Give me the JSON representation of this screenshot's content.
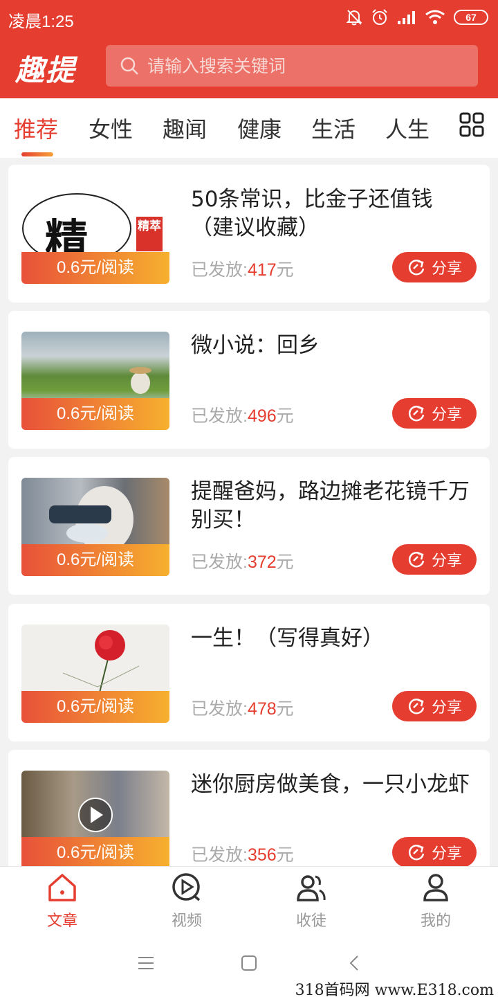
{
  "status_bar": {
    "time": "凌晨1:25",
    "battery": "67",
    "icons": [
      "bell-off-icon",
      "alarm-icon",
      "signal-icon",
      "wifi-icon",
      "battery-icon"
    ]
  },
  "header": {
    "logo": "趣提",
    "search_placeholder": "请输入搜索关键词",
    "search_icon": "search-icon"
  },
  "tabs": {
    "items": [
      "推荐",
      "女性",
      "趣闻",
      "健康",
      "生活",
      "人生"
    ],
    "active": "推荐",
    "more_icon": "grid-icon"
  },
  "feed": {
    "payout_label": "已发放:",
    "currency": "元",
    "share_label": "分享",
    "items": [
      {
        "title": "50条常识，比金子还值钱（建议收藏）",
        "price_badge": "0.6元/阅读",
        "payout": "417"
      },
      {
        "title": "微小说：回乡",
        "price_badge": "0.6元/阅读",
        "payout": "496"
      },
      {
        "title": "提醒爸妈，路边摊老花镜千万别买！",
        "price_badge": "0.6元/阅读",
        "payout": "372"
      },
      {
        "title": "一生！（写得真好）",
        "price_badge": "0.6元/阅读",
        "payout": "478"
      },
      {
        "title": "迷你厨房做美食，一只小龙虾",
        "price_badge": "0.6元/阅读",
        "payout": "356"
      }
    ],
    "thumb_text": "精",
    "thumb_stamp": "精萃"
  },
  "bottom_nav": {
    "items": [
      {
        "label": "文章",
        "icon": "home-icon",
        "active": true
      },
      {
        "label": "视频",
        "icon": "video-icon",
        "active": false
      },
      {
        "label": "收徒",
        "icon": "users-icon",
        "active": false
      },
      {
        "label": "我的",
        "icon": "profile-icon",
        "active": false
      }
    ]
  },
  "watermark": "318首码网 www.E318.com",
  "colors": {
    "primary": "#e53e30",
    "badge_start": "#e8513a",
    "badge_end": "#f6b02e"
  }
}
